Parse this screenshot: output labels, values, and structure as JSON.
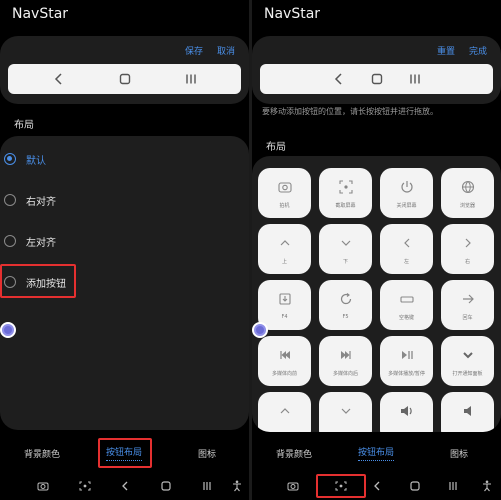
{
  "left": {
    "title": "NavStar",
    "actions": {
      "save": "保存",
      "cancel": "取消"
    },
    "section": "布局",
    "options": [
      {
        "label": "默认",
        "selected": true
      },
      {
        "label": "右对齐",
        "selected": false
      },
      {
        "label": "左对齐",
        "selected": false
      },
      {
        "label": "添加按钮",
        "selected": false
      }
    ],
    "tabs": [
      "背景颜色",
      "按钮布局",
      "图标"
    ],
    "active_tab": 1
  },
  "right": {
    "title": "NavStar",
    "actions": {
      "reset": "重置",
      "done": "完成"
    },
    "hint": "要移动添加按钮的位置，请长按按钮并进行拖放。",
    "section": "布局",
    "tiles": [
      {
        "label": "拍机",
        "icon": "camera-icon"
      },
      {
        "label": "截取屏幕",
        "icon": "screenshot-icon"
      },
      {
        "label": "关闭屏幕",
        "icon": "power-icon"
      },
      {
        "label": "浏览器",
        "icon": "globe-icon"
      },
      {
        "label": "上",
        "icon": "chevron-up-icon"
      },
      {
        "label": "下",
        "icon": "chevron-down-icon"
      },
      {
        "label": "左",
        "icon": "chevron-left-icon"
      },
      {
        "label": "右",
        "icon": "chevron-right-icon"
      },
      {
        "label": "F4",
        "icon": "download-box-icon"
      },
      {
        "label": "F5",
        "icon": "refresh-icon"
      },
      {
        "label": "空格键",
        "icon": "space-key-icon"
      },
      {
        "label": "回车",
        "icon": "arrow-right-icon"
      },
      {
        "label": "多媒体向前",
        "icon": "skip-back-icon"
      },
      {
        "label": "多媒体向后",
        "icon": "skip-forward-icon"
      },
      {
        "label": "多媒体播放/暂停",
        "icon": "play-pause-icon"
      },
      {
        "label": "打开通知面板",
        "icon": "chevron-down-thick-icon"
      },
      {
        "label": "",
        "icon": "chevron-up-icon"
      },
      {
        "label": "",
        "icon": "chevron-down-icon"
      },
      {
        "label": "",
        "icon": "volume-icon"
      },
      {
        "label": "",
        "icon": "volume-down-icon"
      }
    ],
    "tabs": [
      "背景颜色",
      "按钮布局",
      "图标"
    ],
    "active_tab": 1
  },
  "colors": {
    "accent": "#4a8fe8",
    "highlight": "#e53030",
    "card": "#1e1e1e"
  }
}
